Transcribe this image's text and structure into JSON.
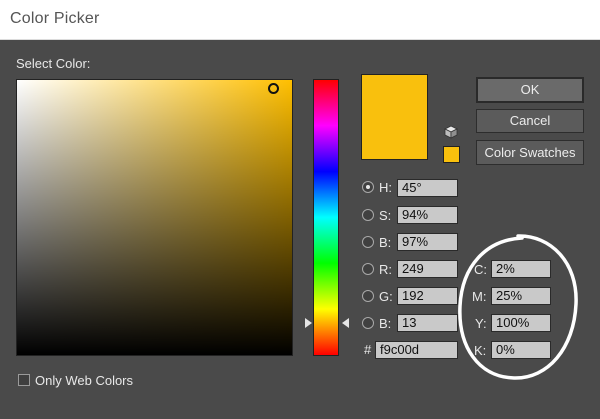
{
  "window": {
    "title": "Color Picker"
  },
  "picker": {
    "select_label": "Select Color:",
    "web_colors_label": "Only Web Colors",
    "hex_symbol": "#",
    "hex_value": "f9c00d"
  },
  "fields": {
    "h": {
      "label": "H:",
      "value": "45°"
    },
    "s": {
      "label": "S:",
      "value": "94%"
    },
    "b": {
      "label": "B:",
      "value": "97%"
    },
    "r": {
      "label": "R:",
      "value": "249"
    },
    "g": {
      "label": "G:",
      "value": "192"
    },
    "bl": {
      "label": "B:",
      "value": "13"
    }
  },
  "cmyk": {
    "c": {
      "label": "C:",
      "value": "2%"
    },
    "m": {
      "label": "M:",
      "value": "25%"
    },
    "y": {
      "label": "Y:",
      "value": "100%"
    },
    "k": {
      "label": "K:",
      "value": "0%"
    }
  },
  "buttons": {
    "ok": "OK",
    "cancel": "Cancel",
    "swatches": "Color Swatches"
  },
  "colors": {
    "current": "#f9c00d",
    "hue": "#ffbf00",
    "panel": "#4a4a4a"
  },
  "icons": {
    "gamut_warning": "cube-icon",
    "hue_slider_arrows": "triangle-arrows"
  }
}
